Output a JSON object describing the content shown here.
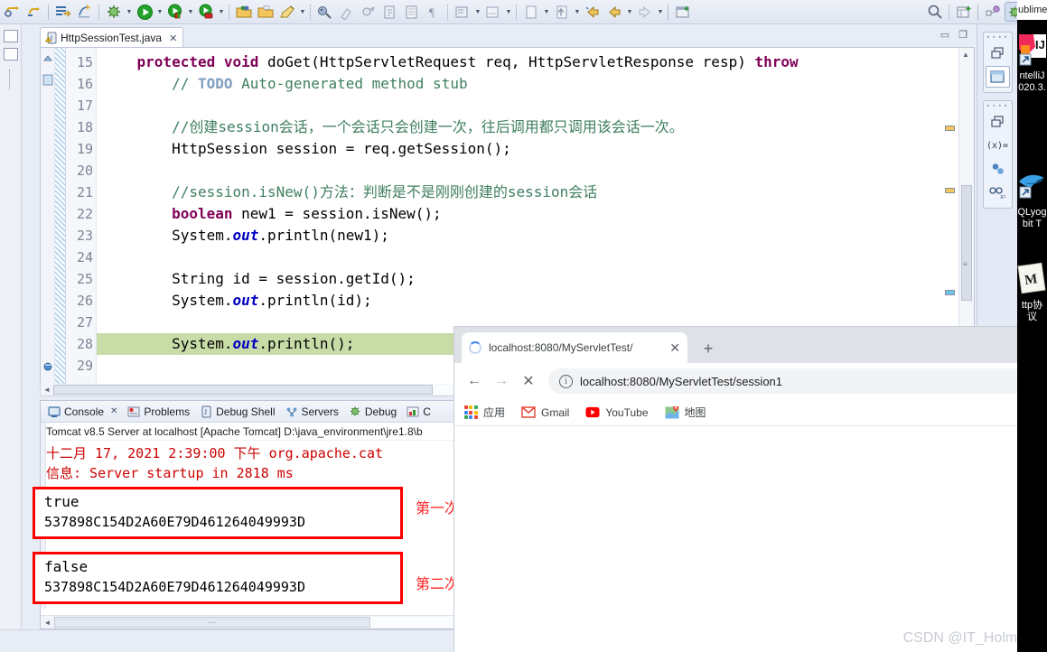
{
  "ide": {
    "editor_tab": {
      "title": "HttpSessionTest.java",
      "close": "✕",
      "icon": "java-file-warning-icon"
    },
    "window_controls": {
      "minimize": "▭",
      "maximize": "❐"
    },
    "gutter_lines": [
      "15",
      "16",
      "17",
      "18",
      "19",
      "20",
      "21",
      "22",
      "23",
      "24",
      "25",
      "26",
      "27",
      "28",
      "29"
    ],
    "code_lines": [
      {
        "num": "15",
        "segments": [
          {
            "t": "    ",
            "c": "pl"
          },
          {
            "t": "protected void ",
            "c": "kw"
          },
          {
            "t": "doGet(HttpServletRequest req, HttpServletResponse resp) ",
            "c": "plain"
          },
          {
            "t": "throw",
            "c": "kw"
          }
        ]
      },
      {
        "num": "16",
        "segments": [
          {
            "t": "        ",
            "c": "pl"
          },
          {
            "t": "// ",
            "c": "cm"
          },
          {
            "t": "TODO",
            "c": "todo"
          },
          {
            "t": " Auto-generated method stub",
            "c": "cm"
          }
        ]
      },
      {
        "num": "17",
        "segments": []
      },
      {
        "num": "18",
        "segments": [
          {
            "t": "        ",
            "c": "pl"
          },
          {
            "t": "//创建session会话，一个会话只会创建一次，往后调用都只调用该会话一次。",
            "c": "cm"
          }
        ]
      },
      {
        "num": "19",
        "segments": [
          {
            "t": "        ",
            "c": "pl"
          },
          {
            "t": "HttpSession session = req.getSession();",
            "c": "plain"
          }
        ]
      },
      {
        "num": "20",
        "segments": []
      },
      {
        "num": "21",
        "segments": [
          {
            "t": "        ",
            "c": "pl"
          },
          {
            "t": "//session.isNew()方法：判断是不是刚刚创建的session会话",
            "c": "cm"
          }
        ]
      },
      {
        "num": "22",
        "segments": [
          {
            "t": "        ",
            "c": "pl"
          },
          {
            "t": "boolean ",
            "c": "kw"
          },
          {
            "t": "new1 = session.isNew();",
            "c": "plain"
          }
        ]
      },
      {
        "num": "23",
        "segments": [
          {
            "t": "        ",
            "c": "pl"
          },
          {
            "t": "System.",
            "c": "plain"
          },
          {
            "t": "out",
            "c": "fld"
          },
          {
            "t": ".println(new1);",
            "c": "plain"
          }
        ]
      },
      {
        "num": "24",
        "segments": []
      },
      {
        "num": "25",
        "segments": [
          {
            "t": "        ",
            "c": "pl"
          },
          {
            "t": "String id = session.getId();",
            "c": "plain"
          }
        ]
      },
      {
        "num": "26",
        "segments": [
          {
            "t": "        ",
            "c": "pl"
          },
          {
            "t": "System.",
            "c": "plain"
          },
          {
            "t": "out",
            "c": "fld"
          },
          {
            "t": ".println(id);",
            "c": "plain"
          }
        ]
      },
      {
        "num": "27",
        "segments": []
      },
      {
        "num": "28",
        "highlight": true,
        "segments": [
          {
            "t": "        ",
            "c": "pl"
          },
          {
            "t": "System.",
            "c": "plain"
          },
          {
            "t": "out",
            "c": "fld"
          },
          {
            "t": ".println();",
            "c": "plain"
          }
        ]
      },
      {
        "num": "29",
        "segments": []
      }
    ],
    "toolbar_icons": [
      "undo-arrow-icon",
      "redo-arrow-icon",
      "sep",
      "run-last-tool-icon",
      "skip-breakpoints-icon",
      "sep-dot",
      "debug-bug-icon",
      "arrow",
      "run-play-icon",
      "arrow",
      "run-as-server-icon",
      "arrow",
      "debug-server-icon",
      "arrow",
      "sep-dot",
      "open-package-icon",
      "open-type-icon",
      "edit-pencil-icon",
      "arrow",
      "sep-dot",
      "search-bird-icon",
      "clean-brush-icon",
      "external-tools-icon",
      "new-xml-icon",
      "task-list-icon",
      "paragraph-mark-icon",
      "sep-dot",
      "tags-icon",
      "arrow",
      "tags2-icon",
      "arrow",
      "sep-dot",
      "back-arrow-icon",
      "prev-arrow-icon",
      "arrow",
      "next-arrow-icon",
      "arrow",
      "sep-solid",
      "new-window-icon"
    ],
    "toolbar_right_icons": [
      "search-magnifier-icon",
      "sep-dot",
      "open-perspective-icon",
      "sep-solid",
      "java-ee-perspective-icon",
      "debug-perspective-icon",
      "java-perspective-icon"
    ]
  },
  "console": {
    "tabs": [
      {
        "label": "Console",
        "icon": "console-icon",
        "active": true,
        "close": "✕"
      },
      {
        "label": "Problems",
        "icon": "problems-icon",
        "active": false
      },
      {
        "label": "Debug Shell",
        "icon": "debug-shell-icon",
        "active": false
      },
      {
        "label": "Servers",
        "icon": "servers-icon",
        "active": false
      },
      {
        "label": "Debug",
        "icon": "debug-icon",
        "active": false
      },
      {
        "label": "C",
        "icon": "coverage-icon",
        "active": false
      }
    ],
    "header": "Tomcat v8.5 Server at localhost [Apache Tomcat] D:\\java_environment\\jre1.8\\b",
    "log_lines": [
      "十二月 17, 2021 2:39:00 下午 org.apache.cat",
      "信息: Server startup in 2818 ms"
    ],
    "scroll_thumb_label": "⋯",
    "box_first": {
      "line1": "true",
      "line2": "537898C154D2A60E79D461264049993D"
    },
    "box_second": {
      "line1": "false",
      "line2": "537898C154D2A60E79D461264049993D"
    }
  },
  "annotations": [
    {
      "text": "第一次访问，创建新session。",
      "color": "#ff2020"
    },
    {
      "text": "第二次访问，依然是之前的session，id也不变。",
      "color": "#ff2020"
    }
  ],
  "browser": {
    "tab": {
      "title": "localhost:8080/MyServletTest/",
      "close": "✕",
      "loading_icon": "spinner-icon"
    },
    "new_tab": "+",
    "nav": {
      "back": "←",
      "forward": "→",
      "stop": "✕",
      "info_icon": "ⓘ"
    },
    "url": "localhost:8080/MyServletTest/session1",
    "bookmarks": [
      {
        "label": "应用",
        "icon": "apps-grid-icon"
      },
      {
        "label": "Gmail",
        "icon": "gmail-icon"
      },
      {
        "label": "YouTube",
        "icon": "youtube-icon"
      },
      {
        "label": "地图",
        "icon": "maps-icon"
      }
    ]
  },
  "desktop": {
    "taskbar_text": "ublime",
    "items": [
      {
        "icon": "intellij-idea-icon",
        "label": "ntelliJ 020.3."
      },
      {
        "icon": "qlyoga-icon",
        "label": "QLyog bit T"
      },
      {
        "icon": "md-file-icon",
        "label": "ttp协议"
      }
    ]
  },
  "watermark": "CSDN @IT_Holmes",
  "colors": {
    "keyword": "#7f0055",
    "comment": "#3f7f5f",
    "field": "#0000c0",
    "highlight_line": "#c8dca8",
    "console_text": "#cc0000",
    "annotation": "#ff2020",
    "chrome_blue": "#4285f4"
  }
}
